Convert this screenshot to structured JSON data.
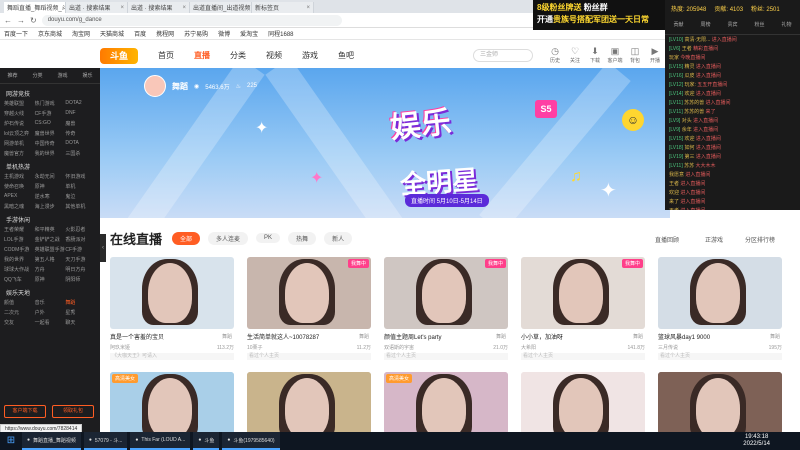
{
  "browser": {
    "tabs": [
      "舞蹈直播_舞蹈视频_斗鱼直播",
      "出道 · 搜索结果",
      "出道 · 搜索结果",
      "出道直播间_出道视频",
      "新标签页"
    ],
    "url": "douyu.com/g_dance",
    "bookmarks": [
      "百度一下",
      "京东商城",
      "淘宝网",
      "天猫商城",
      "百度",
      "携程网",
      "苏宁易购",
      "微博",
      "爱淘宝",
      "同程1688"
    ]
  },
  "header": {
    "logo": "斗鱼",
    "nav": [
      "首页",
      "直播",
      "分类",
      "视频",
      "游戏",
      "鱼吧"
    ],
    "active_nav": "直播",
    "search_placeholder": "三金师",
    "icons": [
      {
        "name": "history",
        "label": "历史"
      },
      {
        "name": "follow",
        "label": "关注"
      },
      {
        "name": "download",
        "label": "下载"
      },
      {
        "name": "message",
        "label": "客户端"
      },
      {
        "name": "bag",
        "label": "背包"
      },
      {
        "name": "broadcast",
        "label": "开播"
      }
    ]
  },
  "sidebar": {
    "top": [
      "推荐",
      "分类",
      "游戏",
      "娱乐"
    ],
    "sections": [
      {
        "title": "网游竞技",
        "items": [
          "英雄联盟",
          "热门游戏",
          "DOTA2",
          "穿越火线",
          "CF手游",
          "DNF",
          "炉石传说",
          "CS:GO",
          "魔兽",
          "lol云顶之弈",
          "魔兽世界",
          "传奇",
          "网游单机",
          "中国传奇",
          "DOTA",
          "魔兽官方",
          "我的世界",
          "三国杀"
        ]
      },
      {
        "title": "单机热游",
        "items": [
          "主机游戏",
          "永劫无间",
          "怀旧游戏",
          "使命召唤",
          "原神",
          "单机",
          "APEX",
          "逆水寒",
          "鬼泣",
          "黑暗之魂",
          "海上漫步",
          "其他单机"
        ]
      },
      {
        "title": "手游休闲",
        "items": [
          "王者荣耀",
          "和平精英",
          "火影忍者",
          "LOL手游",
          "金铲铲之战",
          "香肠派对",
          "CODM手游",
          "英雄联盟手游",
          "CF手游",
          "我的世界",
          "第五人格",
          "天刀手游",
          "球球大作战",
          "方舟",
          "明日方舟",
          "QQ飞车",
          "原神",
          "阴阳师"
        ]
      },
      {
        "title": "娱乐天地",
        "items": [
          "颜值",
          "音乐",
          "舞蹈",
          "二次元",
          "户外",
          "星秀",
          "交友",
          "一起看",
          "聊天"
        ]
      }
    ],
    "buttons": [
      "客户端下载",
      "领取礼包"
    ]
  },
  "banner": {
    "anchor_name": "舞蹈",
    "anchor_fans": "5463.6万",
    "anchor_hot": "225",
    "title": "娱乐",
    "subtitle": "全明星",
    "number": "S5",
    "date": "直播时间 5月10日-5月14日"
  },
  "overlay_ad": {
    "line1": "8级粉丝牌送",
    "line1_tag": "粉丝群",
    "line2": "开通",
    "line2_rest": "贵族号搭配军团送一天日常"
  },
  "chat": {
    "stats": [
      "热度: 205948",
      "贡献: 4103",
      "粉丝: 2501"
    ],
    "tabs": [
      "贡献",
      "周榜",
      "贵宾",
      "粉丝",
      "礼物"
    ],
    "lines": [
      {
        "lv": "[LV10]",
        "nm": "高清·无限...",
        "tx": "进入直播间"
      },
      {
        "lv": "[LV6]",
        "nm": "王者",
        "tx": "精彩直播间"
      },
      {
        "lv": "",
        "nm": "玩家",
        "tx": "今晚直播间"
      },
      {
        "lv": "[LV15]",
        "nm": "精灵",
        "tx": "进入直播间"
      },
      {
        "lv": "[LV16]",
        "nm": "瓜皮",
        "tx": "进入直播间"
      },
      {
        "lv": "[LV12]",
        "nm": "玩家:",
        "tx": "五五开直播间"
      },
      {
        "lv": "[LV14]",
        "nm": "欢迎",
        "tx": "进入直播间"
      },
      {
        "lv": "[LV11]",
        "nm": "苏苏的兽",
        "tx": "进入直播间"
      },
      {
        "lv": "[LV11]",
        "nm": "苏苏的兽",
        "tx": "来了"
      },
      {
        "lv": "[LV9]",
        "nm": "对头",
        "tx": "进入直播间"
      },
      {
        "lv": "[LV9]",
        "nm": "余年",
        "tx": "进入直播间"
      },
      {
        "lv": "[LV15]",
        "nm": "欢迎",
        "tx": "进入直播间"
      },
      {
        "lv": "[LV18]",
        "nm": "如何",
        "tx": "进入直播间"
      },
      {
        "lv": "[LV19]",
        "nm": "第三",
        "tx": "进入直播间"
      },
      {
        "lv": "[LV11]",
        "nm": "苏苏",
        "tx": "大大木木"
      },
      {
        "lv": "",
        "nm": "我愿意",
        "tx": "进入直播间"
      },
      {
        "lv": "",
        "nm": "王者",
        "tx": "进入直播间"
      },
      {
        "lv": "",
        "nm": "欢迎",
        "tx": "进入直播间"
      },
      {
        "lv": "",
        "nm": "来了",
        "tx": "进入直播间"
      },
      {
        "lv": "",
        "nm": "王者",
        "tx": "进入直播间"
      }
    ]
  },
  "live": {
    "title": "在线直播",
    "filters": [
      "全部",
      "多人连麦",
      "PK",
      "热舞",
      "新人"
    ],
    "active_filter": "全部",
    "right": [
      "直播回顾",
      "正游戏",
      "分区排行榜"
    ],
    "cards": [
      {
        "title": "真是一个害羞的宝贝",
        "tag": "舞蹈",
        "owner_name": "阿玖米娅",
        "badge": "",
        "count": "113.2万",
        "bar": "《大咖天王》可请入",
        "color": "#d8e3ec"
      },
      {
        "title": "生活简单就这人~10078287",
        "tag": "舞蹈",
        "owner_name": "10栗子",
        "badge": "我舞中",
        "count": "11.2万",
        "bar": "看过个人主页",
        "color": "#c8b6ad"
      },
      {
        "title": "颜值主题周Let's party",
        "tag": "舞蹈",
        "owner_name": "双语斯的宇宙",
        "badge": "我舞中",
        "count": "21.0万",
        "bar": "看过个人主页",
        "color": "#cfc6c2"
      },
      {
        "title": "小小草，加油呀",
        "tag": "舞蹈",
        "owner_name": "大希阳",
        "badge": "我舞中",
        "count": "141.8万",
        "bar": "看过个人主页",
        "color": "#e3dbd6"
      },
      {
        "title": "篮球风暴day1 9000",
        "tag": "舞蹈",
        "owner_name": "三月传说",
        "badge": "",
        "count": "195万",
        "bar": "看过个人主页",
        "color": "#d4dde6"
      }
    ],
    "row2_colors": [
      "#a9cfe8",
      "#c9b48c",
      "#d6b7c8",
      "#f0e4e4",
      "#7e6156"
    ],
    "row2_badges": [
      "高清美女",
      "",
      "高清美女",
      "",
      ""
    ]
  },
  "status_url": "https://www.douyu.com/7828414",
  "taskbar": {
    "items": [
      "舞蹈直播_舞蹈视频",
      "57079 - 斗...",
      "This Far (LOUD A...",
      "斗鱼",
      "斗鱼(1979585640)"
    ],
    "time": "19:43:18",
    "date": "2022/5/14"
  }
}
